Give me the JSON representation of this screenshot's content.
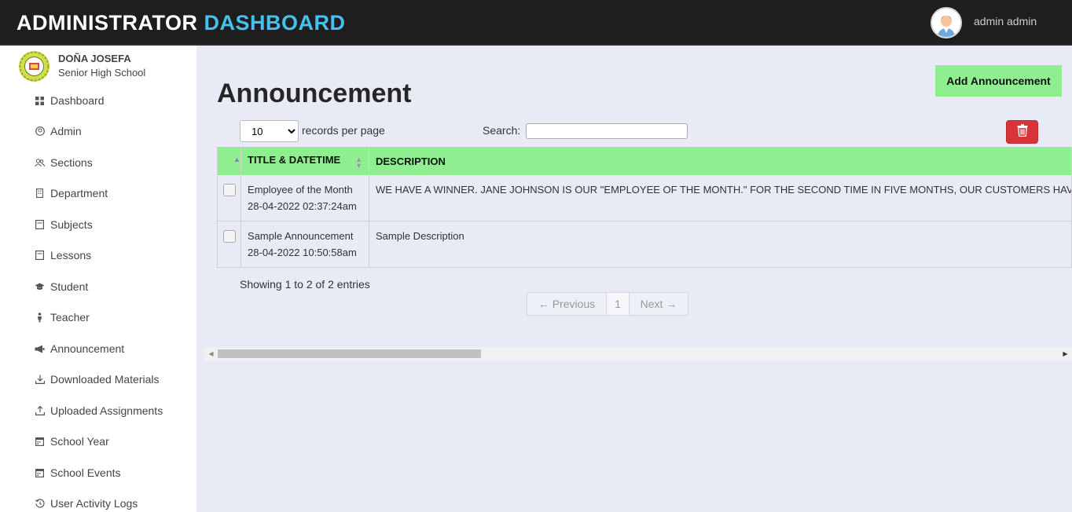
{
  "header": {
    "title_main": "ADMINISTRATOR",
    "title_accent": "DASHBOARD",
    "user_name": "admin admin",
    "accent_color": "#44c1ec"
  },
  "sidebar": {
    "school_line1": "DOÑA JOSEFA",
    "school_line2": "Senior High School",
    "items": [
      {
        "label": "Dashboard",
        "icon": "grid-icon"
      },
      {
        "label": "Admin",
        "icon": "user-circle-icon"
      },
      {
        "label": "Sections",
        "icon": "users-icon"
      },
      {
        "label": "Department",
        "icon": "building-icon"
      },
      {
        "label": "Subjects",
        "icon": "book-icon"
      },
      {
        "label": "Lessons",
        "icon": "book-icon"
      },
      {
        "label": "Student",
        "icon": "graduation-cap-icon"
      },
      {
        "label": "Teacher",
        "icon": "person-icon"
      },
      {
        "label": "Announcement",
        "icon": "bullhorn-icon"
      },
      {
        "label": "Downloaded Materials",
        "icon": "download-icon"
      },
      {
        "label": "Uploaded Assignments",
        "icon": "upload-icon"
      },
      {
        "label": "School Year",
        "icon": "calendar-icon"
      },
      {
        "label": "School Events",
        "icon": "calendar-icon"
      },
      {
        "label": "User Activity Logs",
        "icon": "history-icon"
      }
    ]
  },
  "main": {
    "title": "Announcement",
    "add_button": "Add Announcement",
    "add_button_color": "#8fee8f",
    "length_value": "10",
    "length_label": "records per page",
    "search_label": "Search:",
    "search_value": "",
    "delete_icon": "trash-icon",
    "table": {
      "headers": [
        "",
        "TITLE & DATETIME",
        "DESCRIPTION"
      ],
      "rows": [
        {
          "title": "Employee of the Month",
          "datetime": "28-04-2022 02:37:24am",
          "description": "WE HAVE A WINNER. JANE JOHNSON IS OUR \"EMPLOYEE OF THE MONTH.\" FOR THE SECOND TIME IN FIVE MONTHS, OUR CUSTOMERS HAVE SELEC"
        },
        {
          "title": "Sample Announcement",
          "datetime": "28-04-2022 10:50:58am",
          "description": "Sample Description"
        }
      ]
    },
    "info": "Showing 1 to 2 of 2 entries",
    "pager": {
      "previous": "← Previous",
      "page": "1",
      "next": "Next →"
    }
  }
}
